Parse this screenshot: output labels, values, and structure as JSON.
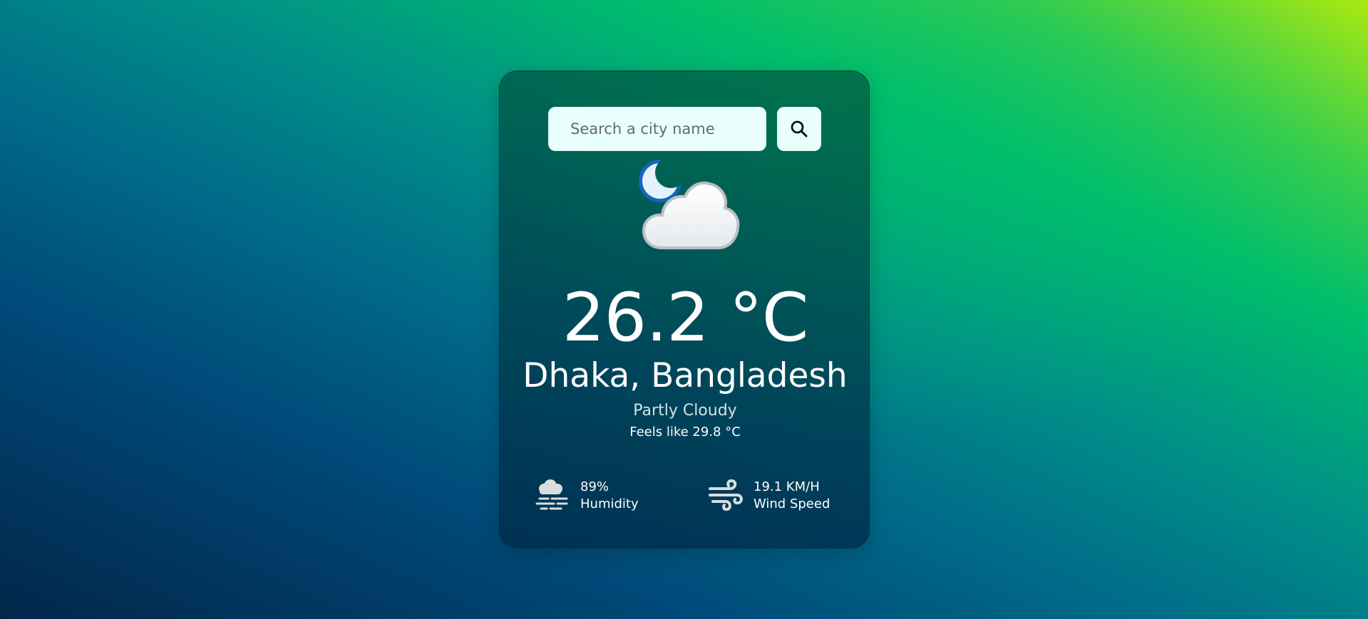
{
  "search": {
    "placeholder": "Search a city name",
    "value": "",
    "button_icon": "search-icon"
  },
  "weather": {
    "icon": "moon-cloud-icon",
    "temperature": "26.2 °C",
    "location": "Dhaka, Bangladesh",
    "condition": "Partly Cloudy",
    "feels_like": "Feels like 29.8 °C"
  },
  "stats": {
    "humidity": {
      "icon": "humidity-icon",
      "value": "89%",
      "label": "Humidity"
    },
    "wind": {
      "icon": "wind-icon",
      "value": "19.1 KM/H",
      "label": "Wind Speed"
    }
  },
  "colors": {
    "input_background": "#e8fffb",
    "text": "#ffffff",
    "condition_text": "#cfe3e6",
    "icon_gray": "#d9dde0"
  }
}
